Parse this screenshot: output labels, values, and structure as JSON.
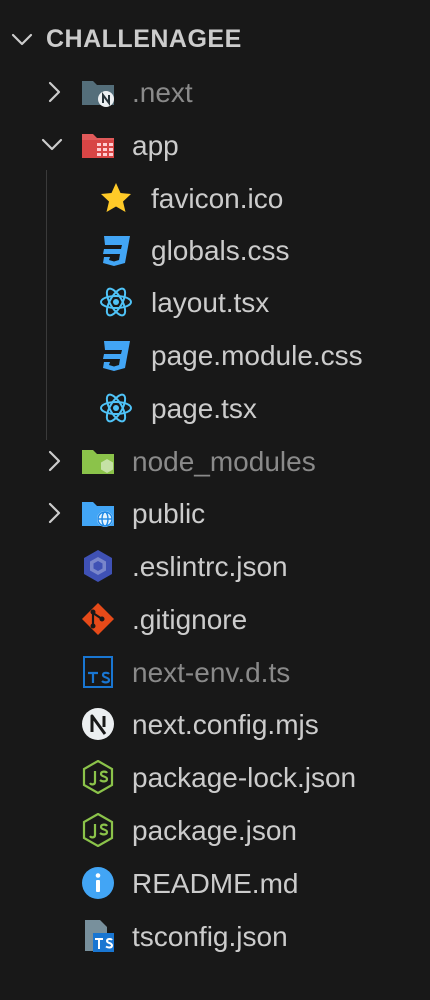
{
  "explorer": {
    "title": "CHALLENAGEE",
    "items": [
      {
        "label": ".next",
        "kind": "folder",
        "state": "collapsed",
        "icon": "folder-next-icon"
      },
      {
        "label": "app",
        "kind": "folder",
        "state": "expanded",
        "icon": "folder-app-icon"
      },
      {
        "label": "favicon.ico",
        "kind": "file",
        "icon": "star-icon"
      },
      {
        "label": "globals.css",
        "kind": "file",
        "icon": "css-icon"
      },
      {
        "label": "layout.tsx",
        "kind": "file",
        "icon": "react-icon"
      },
      {
        "label": "page.module.css",
        "kind": "file",
        "icon": "css-icon"
      },
      {
        "label": "page.tsx",
        "kind": "file",
        "icon": "react-icon"
      },
      {
        "label": "node_modules",
        "kind": "folder",
        "state": "collapsed",
        "icon": "folder-node-icon"
      },
      {
        "label": "public",
        "kind": "folder",
        "state": "collapsed",
        "icon": "folder-public-icon"
      },
      {
        "label": ".eslintrc.json",
        "kind": "file",
        "icon": "eslint-icon"
      },
      {
        "label": ".gitignore",
        "kind": "file",
        "icon": "git-icon"
      },
      {
        "label": "next-env.d.ts",
        "kind": "file",
        "icon": "ts-icon"
      },
      {
        "label": "next.config.mjs",
        "kind": "file",
        "icon": "next-icon"
      },
      {
        "label": "package-lock.json",
        "kind": "file",
        "icon": "nodejs-icon"
      },
      {
        "label": "package.json",
        "kind": "file",
        "icon": "nodejs-icon"
      },
      {
        "label": "README.md",
        "kind": "file",
        "icon": "info-icon"
      },
      {
        "label": "tsconfig.json",
        "kind": "file",
        "icon": "tsconfig-icon"
      }
    ]
  },
  "colors": {
    "background": "#181818",
    "text": "#cccccc",
    "dimmed_text": "#8a8a8a",
    "css": "#42a5f5",
    "react": "#4fc3f7",
    "star": "#ffca28",
    "app_folder": "#e05a5a",
    "node_folder": "#8bc34a",
    "public_folder": "#42a5f5",
    "eslint": "#3f51b5",
    "git": "#e64a19",
    "node_js": "#8bc34a"
  }
}
